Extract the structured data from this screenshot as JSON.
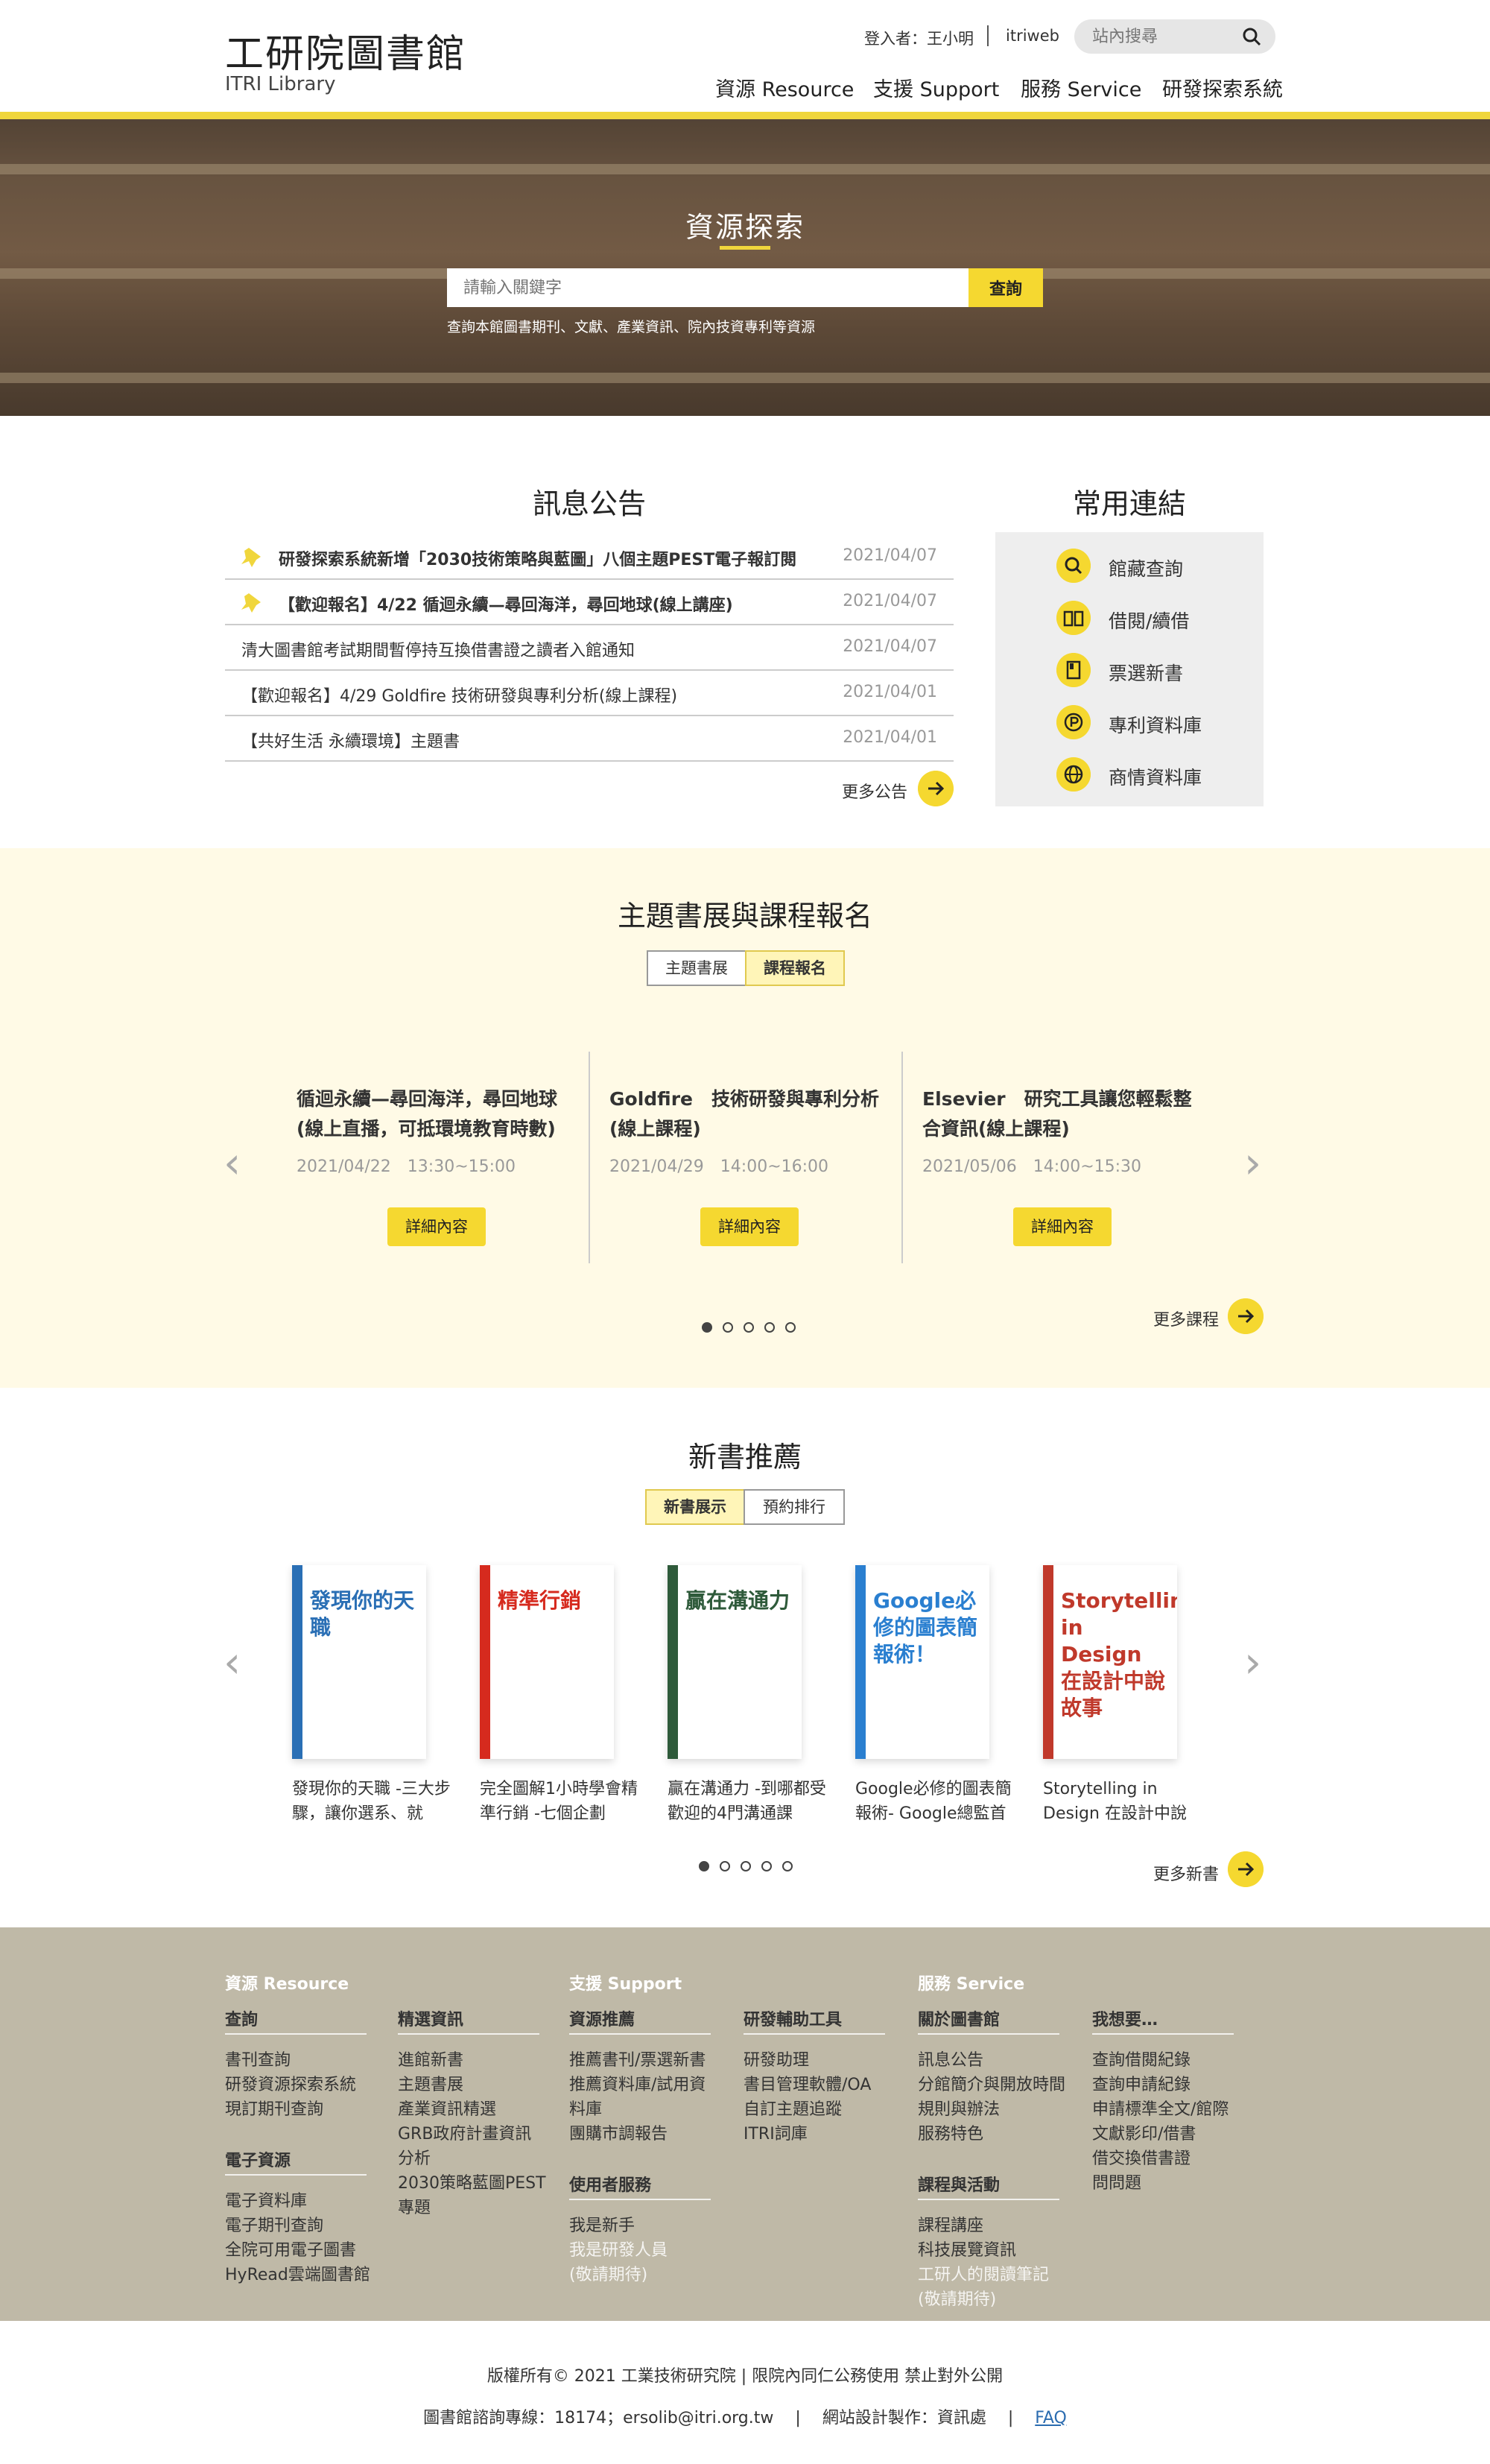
{
  "header": {
    "logo_cn": "工研院圖書館",
    "logo_en": "ITRI Library",
    "login": "登入者：王小明",
    "itriweb": "itriweb",
    "search_placeholder": "站內搜尋",
    "nav": [
      "資源 Resource",
      "支援 Support",
      "服務 Service",
      "研發探索系統"
    ]
  },
  "hero": {
    "title": "資源探索",
    "input_placeholder": "請輸入關鍵字",
    "button": "查詢",
    "hint": "查詢本館圖書期刊、文獻、產業資訊、院內技資專利等資源"
  },
  "news": {
    "title": "訊息公告",
    "items": [
      {
        "text": "研發探索系統新增「2030技術策略與藍圖」八個主題PEST電子報訂閱",
        "date": "2021/04/07",
        "pinned": true
      },
      {
        "text": "【歡迎報名】4/22 循迴永續—尋回海洋，尋回地球(線上講座)",
        "date": "2021/04/07",
        "pinned": true
      },
      {
        "text": "清大圖書館考試期間暫停持互換借書證之讀者入館通知",
        "date": "2021/04/07",
        "pinned": false
      },
      {
        "text": "【歡迎報名】4/29 Goldfire 技術研發與專利分析(線上課程)",
        "date": "2021/04/01",
        "pinned": false
      },
      {
        "text": "【共好生活 永續環境】主題書",
        "date": "2021/04/01",
        "pinned": false
      }
    ],
    "more": "更多公告"
  },
  "links": {
    "title": "常用連結",
    "items": [
      {
        "label": "館藏查詢",
        "icon": "search-icon"
      },
      {
        "label": "借閱/續借",
        "icon": "book-open-icon"
      },
      {
        "label": "票選新書",
        "icon": "book-icon"
      },
      {
        "label": "專利資料庫",
        "icon": "patent-icon"
      },
      {
        "label": "商情資料庫",
        "icon": "globe-icon"
      }
    ]
  },
  "events": {
    "title": "主題書展與課程報名",
    "tabs": [
      "主題書展",
      "課程報名"
    ],
    "active_tab": 1,
    "items": [
      {
        "title": "循迴永續—尋回海洋，尋回地球(線上直播，可抵環境教育時數)",
        "date": "2021/04/22　13:30~15:00",
        "button": "詳細內容"
      },
      {
        "title": "Goldfire　技術研發與專利分析(線上課程)",
        "date": "2021/04/29　14:00~16:00",
        "button": "詳細內容"
      },
      {
        "title": "Elsevier　研究工具讓您輕鬆整合資訊(線上課程)",
        "date": "2021/05/06　14:00~15:30",
        "button": "詳細內容"
      }
    ],
    "more": "更多課程",
    "page_count": 5,
    "current_page": 1
  },
  "books": {
    "title": "新書推薦",
    "tabs": [
      "新書展示",
      "預約排行"
    ],
    "active_tab": 0,
    "items": [
      {
        "title": "發現你的天職 -三大步驟，讓你選系、就",
        "cover_text": "發現你的天職",
        "color": "#2a6fb5"
      },
      {
        "title": "完全圖解1小時學會精準行銷 -七個企劃",
        "cover_text": "精準行銷",
        "color": "#d62a1e"
      },
      {
        "title": "贏在溝通力 -到哪都受歡迎的4門溝通課",
        "cover_text": "贏在溝通力",
        "color": "#2e5a3a"
      },
      {
        "title": "Google必修的圖表簡報術- Google總監首",
        "cover_text": "Google必修的圖表簡報術！",
        "color": "#2a7fd0"
      },
      {
        "title": "Storytelling in Design 在設計中說",
        "cover_text": "Storytelling in Design 在設計中說故事",
        "color": "#c0392b"
      }
    ],
    "more": "更多新書",
    "page_count": 5,
    "current_page": 1
  },
  "footer": {
    "cols": [
      {
        "head": "資源 Resource",
        "groups": [
          {
            "sub": "查詢",
            "items": [
              "書刊查詢",
              "研發資源探索系統",
              "現訂期刊查詢"
            ]
          },
          {
            "sub": "電子資源",
            "items": [
              "電子資料庫",
              "電子期刊查詢",
              "全院可用電子圖書",
              "HyRead雲端圖書館"
            ]
          }
        ]
      },
      {
        "head": "",
        "groups": [
          {
            "sub": "精選資訊",
            "items": [
              "進館新書",
              "主題書展",
              "產業資訊精選",
              "GRB政府計畫資訊",
              "分析",
              "2030策略藍圖PEST",
              "專題"
            ]
          }
        ]
      },
      {
        "head": "支援 Support",
        "groups": [
          {
            "sub": "資源推薦",
            "items": [
              "推薦書刊/票選新書",
              "推薦資料庫/試用資",
              "料庫",
              "團購市調報告"
            ]
          },
          {
            "sub": "使用者服務",
            "items": [
              "我是新手",
              "我是研發人員",
              "(敬請期待)"
            ],
            "dim_from": 1
          }
        ]
      },
      {
        "head": "",
        "groups": [
          {
            "sub": "研發輔助工具",
            "items": [
              "研發助理",
              "書目管理軟體/OA",
              "自訂主題追蹤",
              "ITRI詞庫"
            ]
          }
        ]
      },
      {
        "head": "服務 Service",
        "groups": [
          {
            "sub": "關於圖書館",
            "items": [
              "訊息公告",
              "分館簡介與開放時間",
              "規則與辦法",
              "服務特色"
            ]
          },
          {
            "sub": "課程與活動",
            "items": [
              "課程講座",
              "科技展覽資訊",
              "工研人的閱讀筆記",
              "(敬請期待)"
            ],
            "dim_from": 2
          }
        ]
      },
      {
        "head": "",
        "groups": [
          {
            "sub": "我想要…",
            "items": [
              "查詢借閱紀錄",
              "查詢申請紀錄",
              "申請標準全文/館際",
              "文獻影印/借書",
              "借交換借書證",
              "問問題"
            ]
          }
        ]
      }
    ],
    "copyright": "版權所有© 2021 工業技術研究院 | 限院內同仁公務使用 禁止對外公開",
    "contact": "圖書館諮詢專線：18174；ersolib@itri.org.tw",
    "made": "網站設計製作：資訊處",
    "faq": "FAQ"
  }
}
